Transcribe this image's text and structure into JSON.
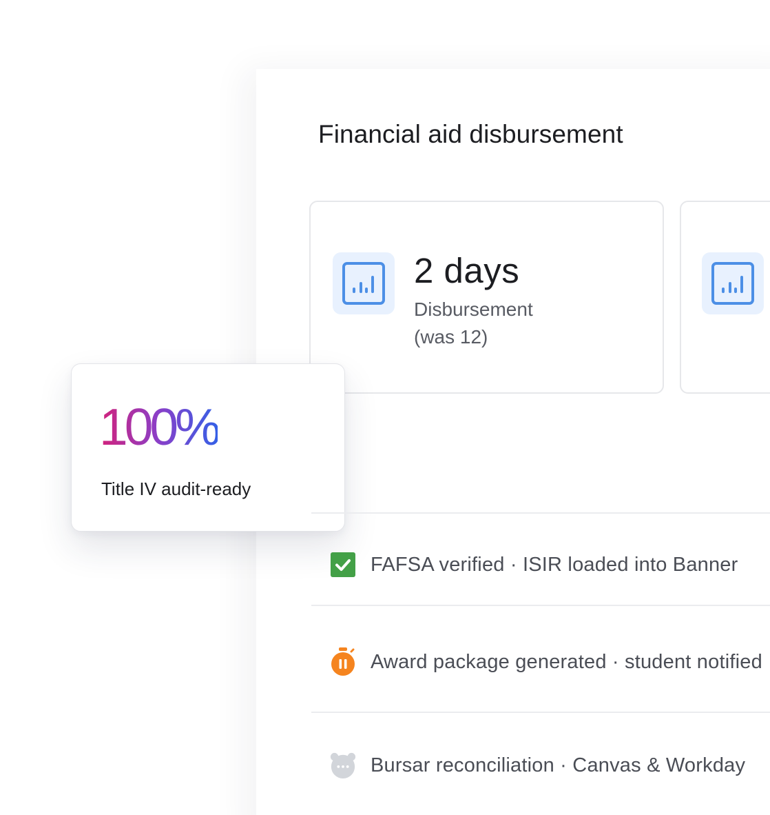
{
  "page": {
    "title": "Financial aid disbursement"
  },
  "stats": [
    {
      "icon": "bar-chart-icon",
      "value": "2 days",
      "label_line1": "Disbursement",
      "label_line2": "(was 12)"
    },
    {
      "icon": "bar-chart-icon",
      "value": "",
      "label_line1": "",
      "label_line2": ""
    }
  ],
  "highlight": {
    "value": "100%",
    "label": "Title IV audit-ready"
  },
  "tasks": [
    {
      "icon": "checkbox-checked-icon",
      "status": "done",
      "label": "FAFSA verified · ISIR loaded into Banner"
    },
    {
      "icon": "paused-timer-icon",
      "status": "in-progress",
      "label": "Award package generated · student notified"
    },
    {
      "icon": "pending-clock-icon",
      "status": "queued",
      "label": "Bursar reconciliation · Canvas & Workday"
    }
  ],
  "colors": {
    "accent_blue": "#4c8fe6",
    "icon_tile_bg": "#e8f1fe",
    "done_green": "#43a047",
    "progress_orange": "#f5841f",
    "pending_gray": "#d2d5da",
    "gradient_start": "#d3227a",
    "gradient_end": "#3560e6"
  }
}
